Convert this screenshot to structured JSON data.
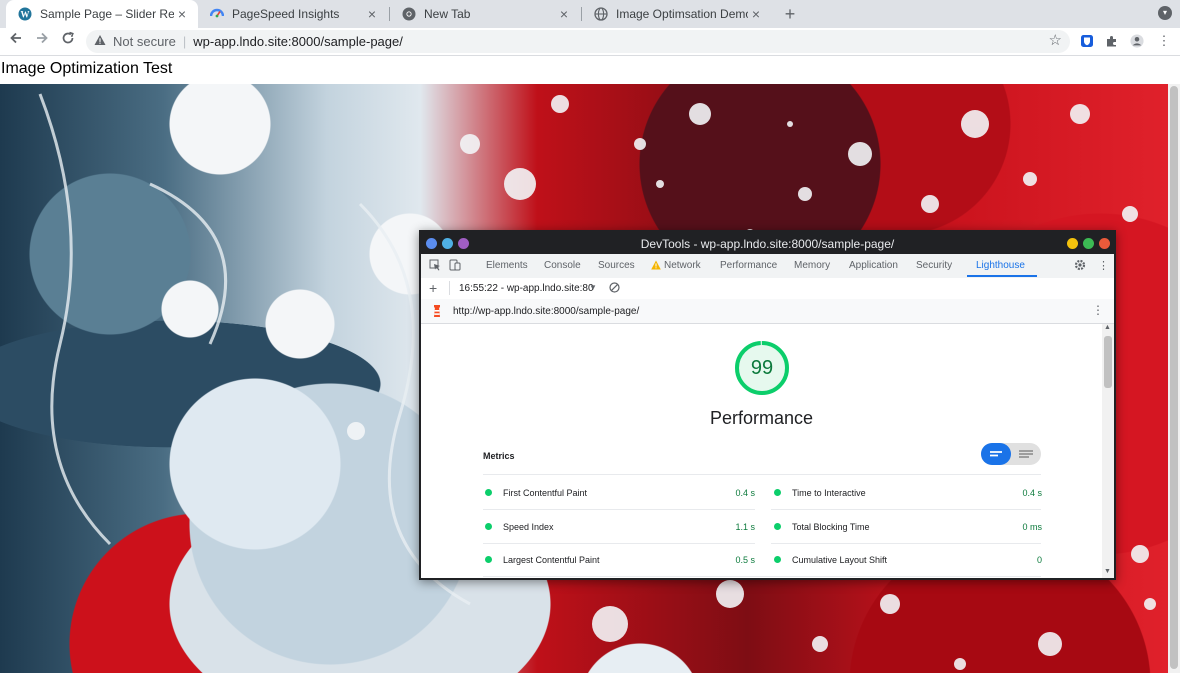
{
  "browser": {
    "tabs": [
      {
        "title": "Sample Page – Slider Revolut",
        "icon": "wordpress-icon",
        "active": true
      },
      {
        "title": "PageSpeed Insights",
        "icon": "pagespeed-icon",
        "active": false
      },
      {
        "title": "New Tab",
        "icon": "chrome-icon",
        "active": false
      },
      {
        "title": "Image Optimsation Demo - Y",
        "icon": "globe-icon",
        "active": false
      }
    ],
    "new_tab": "+",
    "address": {
      "security_text": "Not secure",
      "url": "wp-app.lndo.site:8000/sample-page/"
    },
    "extensions": [
      "bitwarden-icon",
      "puzzle-icon",
      "profile-icon"
    ]
  },
  "page": {
    "heading": "Image Optimization Test"
  },
  "devtools": {
    "title": "DevTools - wp-app.lndo.site:8000/sample-page/",
    "tabs": [
      "Elements",
      "Console",
      "Sources",
      "Network",
      "Performance",
      "Memory",
      "Application",
      "Security",
      "Lighthouse"
    ],
    "active_tab": "Lighthouse",
    "report_selector": "16:55:22 - wp-app.lndo.site:80",
    "report_url": "http://wp-app.lndo.site:8000/sample-page/",
    "score": "99",
    "score_fraction": 0.99,
    "category": "Performance",
    "metrics_heading": "Metrics",
    "metrics": [
      {
        "name": "First Contentful Paint",
        "value": "0.4 s"
      },
      {
        "name": "Time to Interactive",
        "value": "0.4 s"
      },
      {
        "name": "Speed Index",
        "value": "1.1 s"
      },
      {
        "name": "Total Blocking Time",
        "value": "0 ms"
      },
      {
        "name": "Largest Contentful Paint",
        "value": "0.5 s"
      },
      {
        "name": "Cumulative Layout Shift",
        "value": "0"
      }
    ],
    "colors": {
      "pass": "#0cce6b",
      "pass_text": "#0c7a3c",
      "accent": "#1a73e8"
    }
  }
}
